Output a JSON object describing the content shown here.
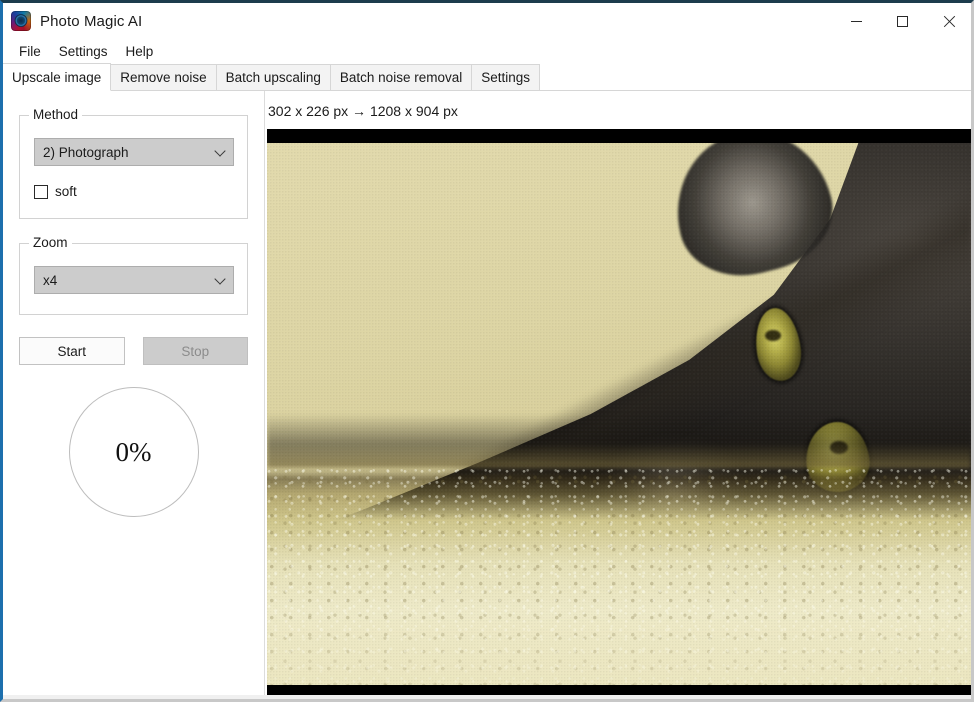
{
  "window": {
    "title": "Photo Magic AI",
    "icon": "app-logo-icon",
    "controls": {
      "minimize": "minimize-icon",
      "maximize": "maximize-icon",
      "close": "close-icon"
    }
  },
  "menubar": {
    "items": [
      {
        "label": "File"
      },
      {
        "label": "Settings"
      },
      {
        "label": "Help"
      }
    ]
  },
  "tabs": [
    {
      "label": "Upscale image",
      "active": true
    },
    {
      "label": "Remove noise",
      "active": false
    },
    {
      "label": "Batch upscaling",
      "active": false
    },
    {
      "label": "Batch noise removal",
      "active": false
    },
    {
      "label": "Settings",
      "active": false
    }
  ],
  "left_panel": {
    "method_group": {
      "title": "Method",
      "combo": {
        "value": "2) Photograph",
        "chevron": "chevron-down-icon"
      },
      "checkbox": {
        "label": "soft",
        "checked": false
      }
    },
    "zoom_group": {
      "title": "Zoom",
      "combo": {
        "value": "x4",
        "chevron": "chevron-down-icon"
      }
    },
    "buttons": {
      "start": {
        "label": "Start",
        "enabled": true
      },
      "stop": {
        "label": "Stop",
        "enabled": false
      }
    },
    "progress": {
      "value": "0%",
      "percent": 0
    }
  },
  "right_panel": {
    "size_label": "302 x 226 px → 1208 x 904 px",
    "source_width": 302,
    "source_height": 226,
    "target_width": 1208,
    "target_height": 904,
    "preview": {
      "alt": "Close-up photograph of a black cat lying on a cream shag carpet with yellow-green eyes",
      "letterbox_color": "#000000"
    }
  },
  "colors": {
    "window_border_top": "#1d3c4d",
    "window_border_left": "#1d6fad",
    "combo_background": "#cccccc",
    "disabled_button": "#cccccc",
    "progress_ring": "#bdbdbd",
    "text": "#1b1b1b"
  }
}
